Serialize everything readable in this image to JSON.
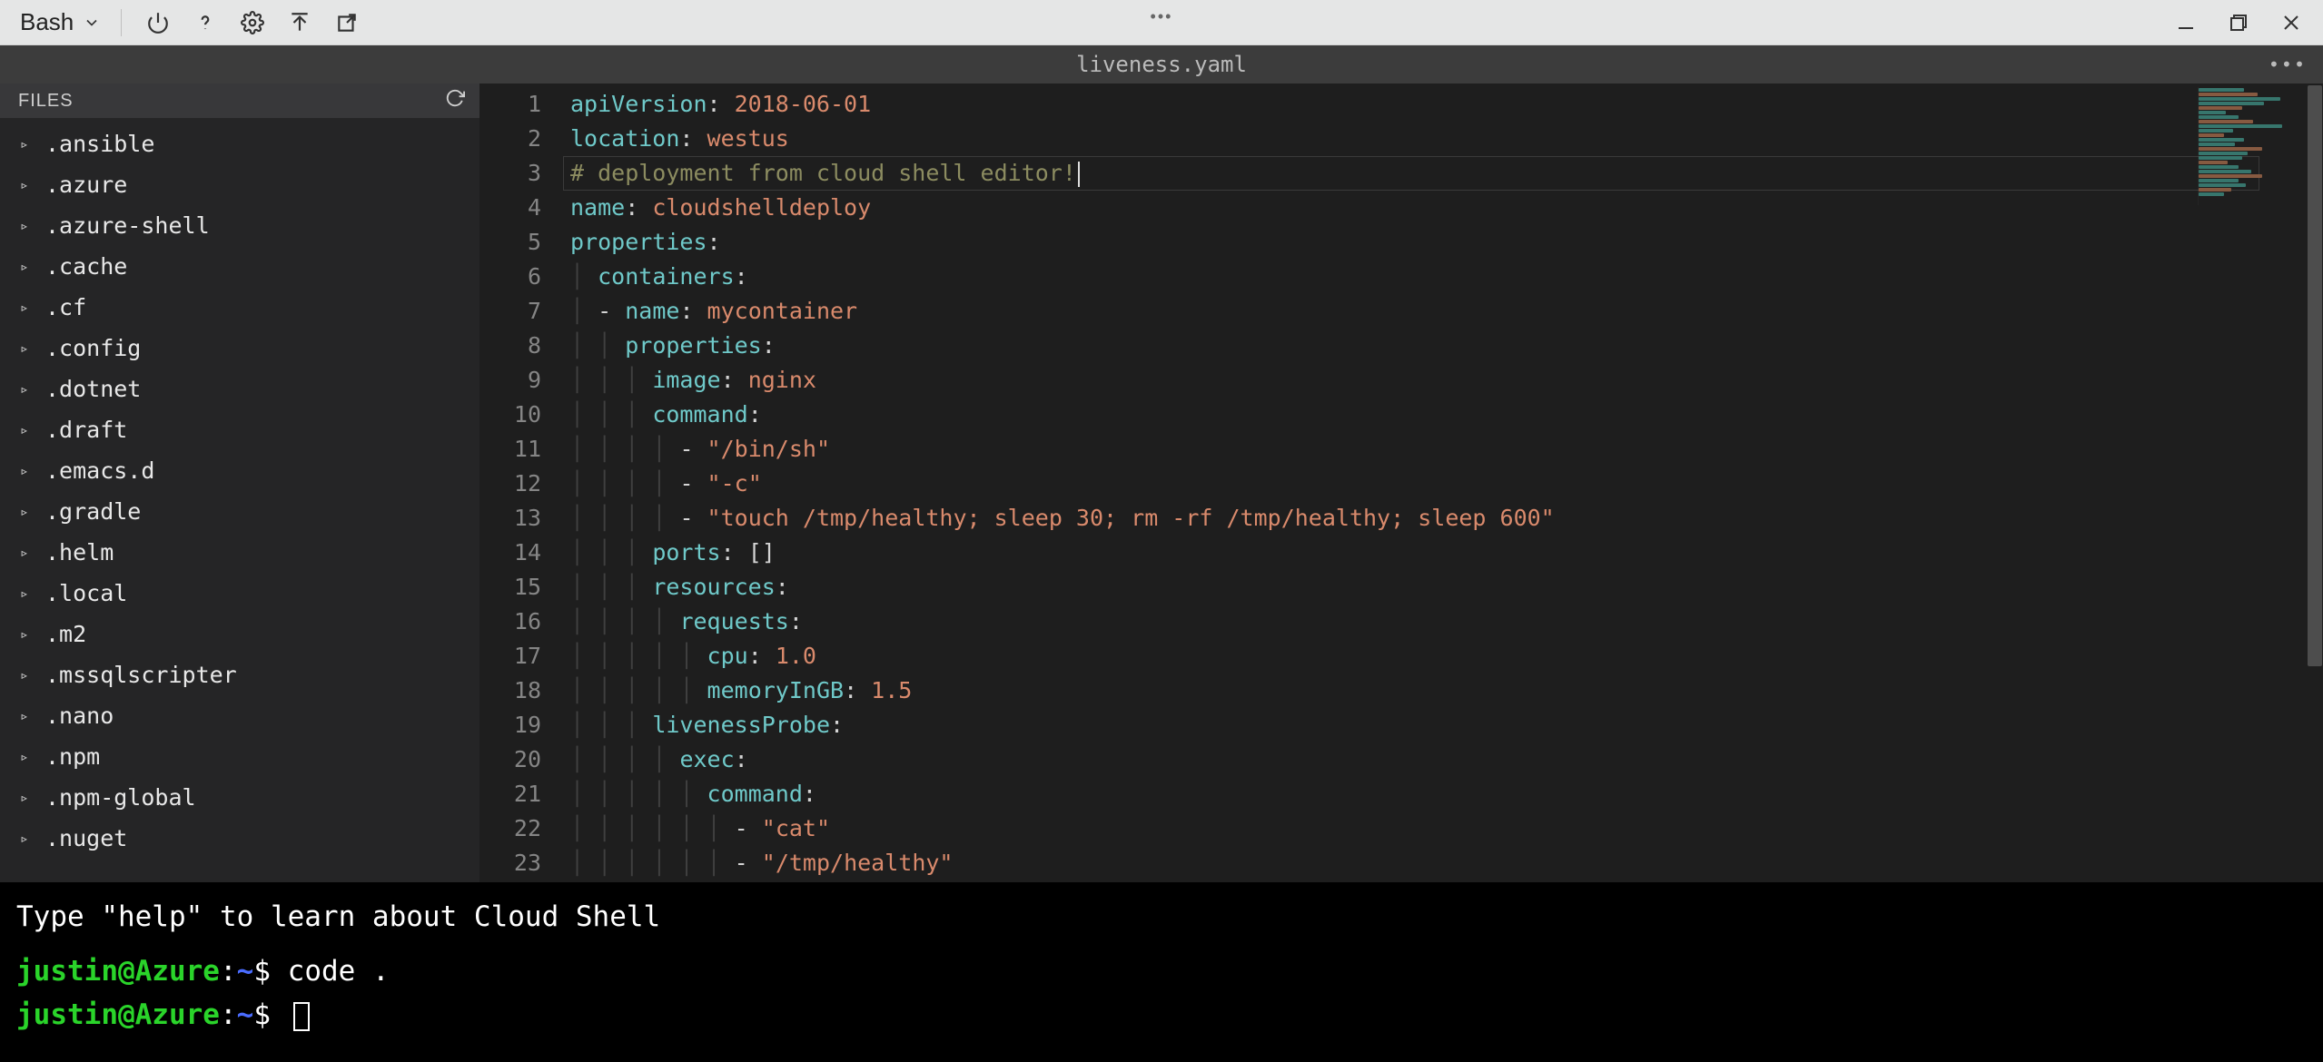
{
  "toolbar": {
    "shell_label": "Bash"
  },
  "editor": {
    "title": "liveness.yaml"
  },
  "sidebar": {
    "header": "FILES",
    "items": [
      ".ansible",
      ".azure",
      ".azure-shell",
      ".cache",
      ".cf",
      ".config",
      ".dotnet",
      ".draft",
      ".emacs.d",
      ".gradle",
      ".helm",
      ".local",
      ".m2",
      ".mssqlscripter",
      ".nano",
      ".npm",
      ".npm-global",
      ".nuget"
    ]
  },
  "code": {
    "lines": [
      {
        "n": 1,
        "ind": 0,
        "segs": [
          [
            "key",
            "apiVersion"
          ],
          [
            "punc",
            ": "
          ],
          [
            "str",
            "2018-06-01"
          ]
        ]
      },
      {
        "n": 2,
        "ind": 0,
        "segs": [
          [
            "key",
            "location"
          ],
          [
            "punc",
            ": "
          ],
          [
            "str",
            "westus"
          ]
        ]
      },
      {
        "n": 3,
        "ind": 0,
        "segs": [
          [
            "comment",
            "# deployment from cloud shell editor!"
          ]
        ],
        "caretAfter": true
      },
      {
        "n": 4,
        "ind": 0,
        "segs": [
          [
            "key",
            "name"
          ],
          [
            "punc",
            ": "
          ],
          [
            "str",
            "cloudshelldeploy"
          ]
        ]
      },
      {
        "n": 5,
        "ind": 0,
        "segs": [
          [
            "key",
            "properties"
          ],
          [
            "punc",
            ":"
          ]
        ]
      },
      {
        "n": 6,
        "ind": 1,
        "segs": [
          [
            "key",
            "containers"
          ],
          [
            "punc",
            ":"
          ]
        ]
      },
      {
        "n": 7,
        "ind": 1,
        "segs": [
          [
            "dash",
            "- "
          ],
          [
            "key",
            "name"
          ],
          [
            "punc",
            ": "
          ],
          [
            "str",
            "mycontainer"
          ]
        ]
      },
      {
        "n": 8,
        "ind": 2,
        "segs": [
          [
            "key",
            "properties"
          ],
          [
            "punc",
            ":"
          ]
        ]
      },
      {
        "n": 9,
        "ind": 3,
        "segs": [
          [
            "key",
            "image"
          ],
          [
            "punc",
            ": "
          ],
          [
            "str",
            "nginx"
          ]
        ]
      },
      {
        "n": 10,
        "ind": 3,
        "segs": [
          [
            "key",
            "command"
          ],
          [
            "punc",
            ":"
          ]
        ]
      },
      {
        "n": 11,
        "ind": 4,
        "segs": [
          [
            "dash",
            "- "
          ],
          [
            "str",
            "\"/bin/sh\""
          ]
        ]
      },
      {
        "n": 12,
        "ind": 4,
        "segs": [
          [
            "dash",
            "- "
          ],
          [
            "str",
            "\"-c\""
          ]
        ]
      },
      {
        "n": 13,
        "ind": 4,
        "segs": [
          [
            "dash",
            "- "
          ],
          [
            "str",
            "\"touch /tmp/healthy; sleep 30; rm -rf /tmp/healthy; sleep 600\""
          ]
        ]
      },
      {
        "n": 14,
        "ind": 3,
        "segs": [
          [
            "key",
            "ports"
          ],
          [
            "punc",
            ": "
          ],
          [
            "punc",
            "[]"
          ]
        ]
      },
      {
        "n": 15,
        "ind": 3,
        "segs": [
          [
            "key",
            "resources"
          ],
          [
            "punc",
            ":"
          ]
        ]
      },
      {
        "n": 16,
        "ind": 4,
        "segs": [
          [
            "key",
            "requests"
          ],
          [
            "punc",
            ":"
          ]
        ]
      },
      {
        "n": 17,
        "ind": 5,
        "segs": [
          [
            "key",
            "cpu"
          ],
          [
            "punc",
            ": "
          ],
          [
            "num",
            "1.0"
          ]
        ]
      },
      {
        "n": 18,
        "ind": 5,
        "segs": [
          [
            "key",
            "memoryInGB"
          ],
          [
            "punc",
            ": "
          ],
          [
            "num",
            "1.5"
          ]
        ]
      },
      {
        "n": 19,
        "ind": 3,
        "segs": [
          [
            "key",
            "livenessProbe"
          ],
          [
            "punc",
            ":"
          ]
        ]
      },
      {
        "n": 20,
        "ind": 4,
        "segs": [
          [
            "key",
            "exec"
          ],
          [
            "punc",
            ":"
          ]
        ]
      },
      {
        "n": 21,
        "ind": 5,
        "segs": [
          [
            "key",
            "command"
          ],
          [
            "punc",
            ":"
          ]
        ]
      },
      {
        "n": 22,
        "ind": 6,
        "segs": [
          [
            "dash",
            "- "
          ],
          [
            "str",
            "\"cat\""
          ]
        ]
      },
      {
        "n": 23,
        "ind": 6,
        "segs": [
          [
            "dash",
            "- "
          ],
          [
            "str",
            "\"/tmp/healthy\""
          ]
        ]
      }
    ],
    "highlight_line_index": 2
  },
  "terminal": {
    "help_line": "Type \"help\" to learn about Cloud Shell",
    "prompt_user": "justin@Azure",
    "prompt_path": "~",
    "prompt_suffix": "$",
    "cmd1": "code .",
    "cmd2": ""
  },
  "minimap_lines": [
    50,
    65,
    90,
    72,
    48,
    30,
    44,
    60,
    92,
    38,
    28,
    50,
    40,
    70,
    54,
    48,
    32,
    44,
    58,
    70,
    44,
    52,
    36,
    28
  ]
}
